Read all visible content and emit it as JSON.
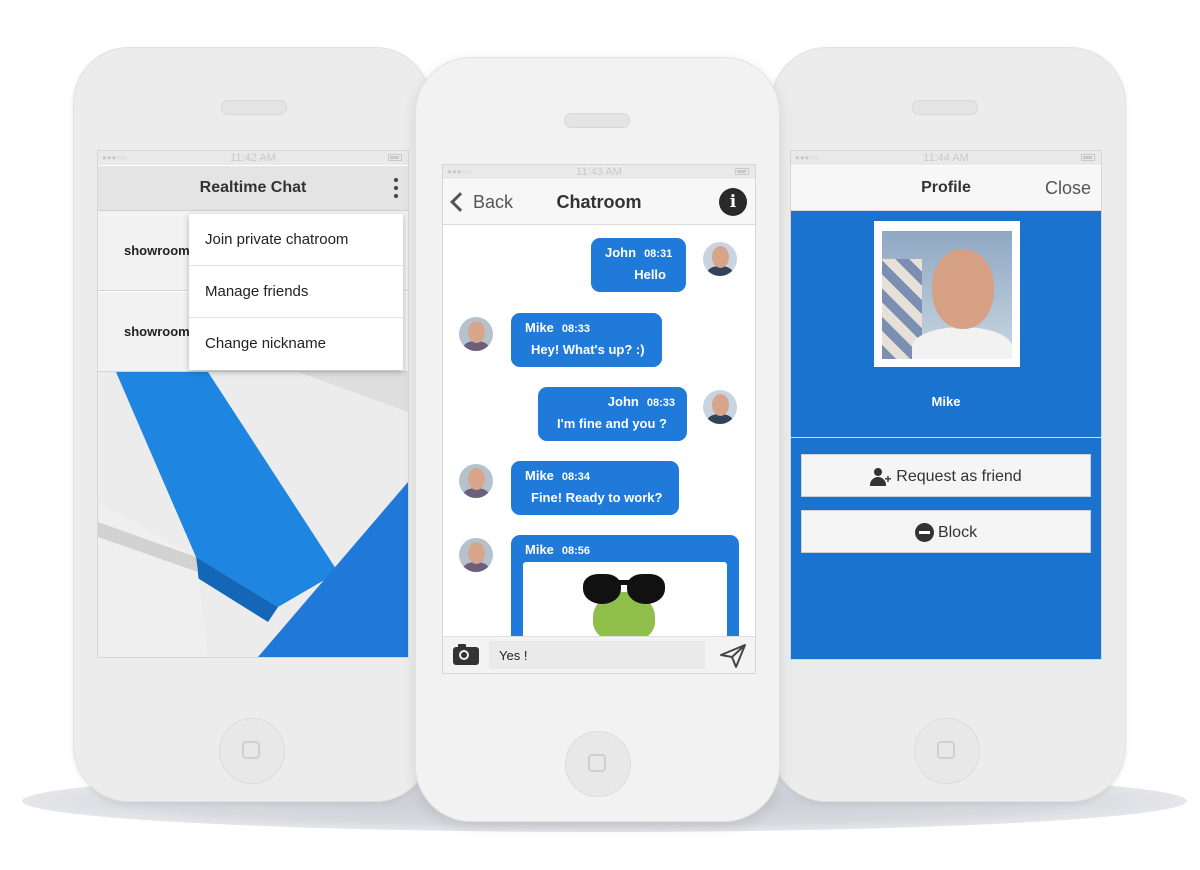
{
  "phones": [
    {
      "status_time": "11:42 AM",
      "header_title": "Realtime Chat",
      "rooms": [
        "showroom",
        "showroom"
      ],
      "menu_items": [
        "Join private chatroom",
        "Manage friends",
        "Change nickname"
      ]
    },
    {
      "status_time": "11:43 AM",
      "back_label": "Back",
      "header_title": "Chatroom",
      "messages": [
        {
          "name": "John",
          "time": "08:31",
          "text": "Hello"
        },
        {
          "name": "Mike",
          "time": "08:33",
          "text": "Hey! What's up? :)"
        },
        {
          "name": "John",
          "time": "08:33",
          "text": "I'm fine and you ?"
        },
        {
          "name": "Mike",
          "time": "08:34",
          "text": "Fine! Ready to work?"
        },
        {
          "name": "Mike",
          "time": "08:56",
          "text": ""
        }
      ],
      "input_value": "Yes !"
    },
    {
      "status_time": "11:44 AM",
      "header_title": "Profile",
      "close_label": "Close",
      "profile_name": "Mike",
      "request_label": "Request as friend",
      "block_label": "Block"
    }
  ],
  "colors": {
    "accent": "#1f7ad9",
    "profile_bg": "#1a73cf",
    "phone_body": "#ececec"
  },
  "icons": [
    "kebab-menu-icon",
    "chevron-left-icon",
    "info-icon",
    "camera-icon",
    "send-icon",
    "user-plus-icon",
    "minus-circle-icon"
  ]
}
